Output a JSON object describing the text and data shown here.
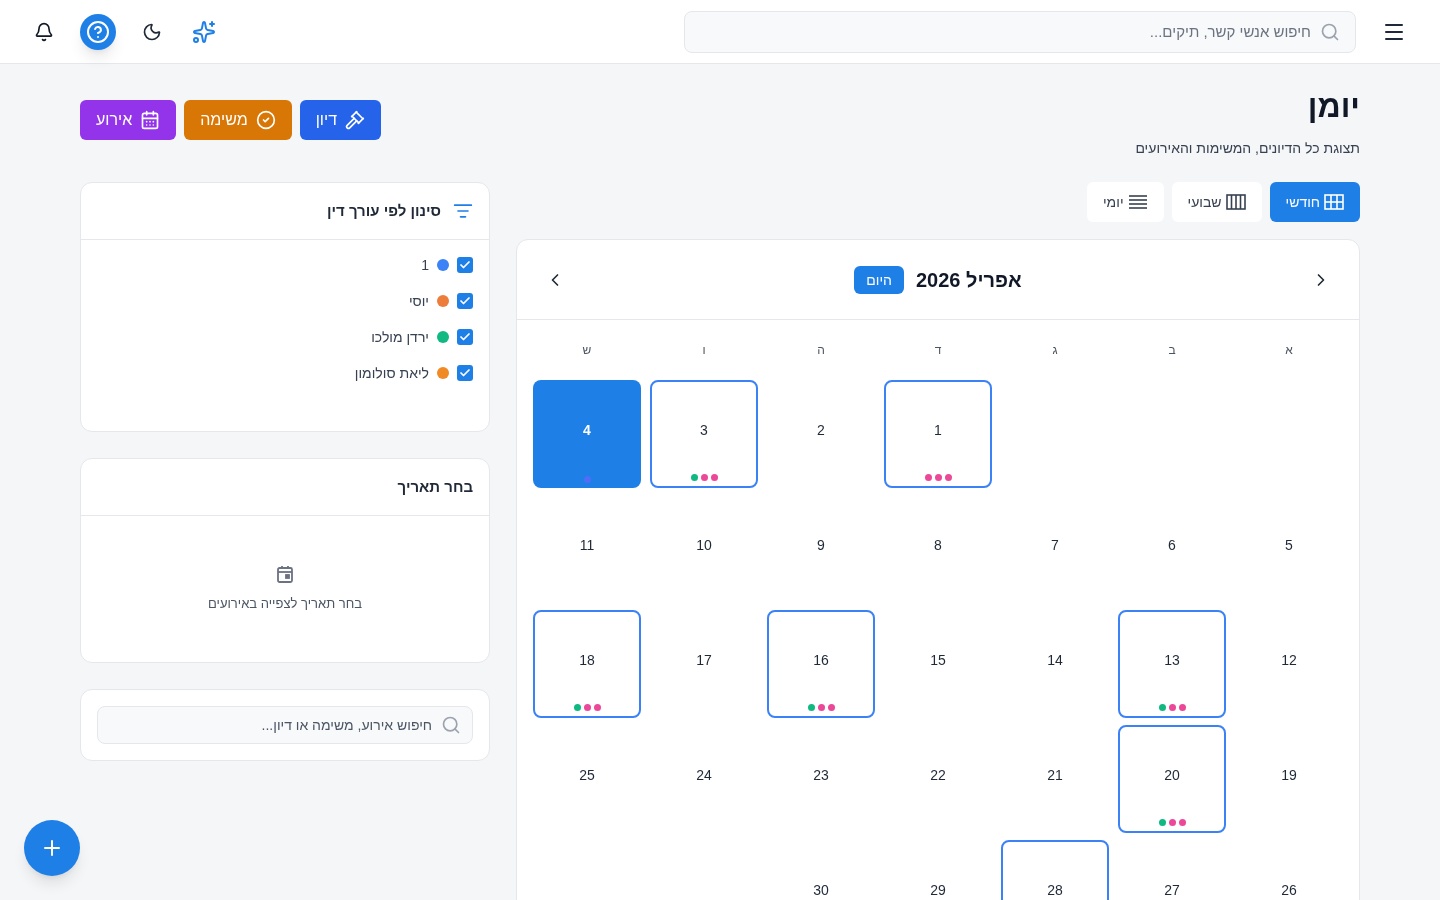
{
  "header": {
    "search": {
      "placeholder": "חיפוש אנשי קשר, תיקים..."
    }
  },
  "page": {
    "title": "יומן",
    "subtitle": "תצוגת כל הדיונים, המשימות והאירועים"
  },
  "create_buttons": [
    {
      "label": "דיון",
      "kind": "hearing"
    },
    {
      "label": "משימה",
      "kind": "task"
    },
    {
      "label": "אירוע",
      "kind": "event"
    }
  ],
  "view_tabs": [
    {
      "label": "חודשי",
      "kind": "month",
      "selected": true
    },
    {
      "label": "שבועי",
      "kind": "week",
      "selected": false
    },
    {
      "label": "יומי",
      "kind": "day",
      "selected": false
    }
  ],
  "calendar": {
    "title": "אפריל 2026",
    "today_button": "היום",
    "weekdays": [
      "א",
      "ב",
      "ג",
      "ד",
      "ה",
      "ו",
      "ש"
    ],
    "weeks": [
      [
        {
          "kind": "blank"
        },
        {
          "kind": "blank"
        },
        {
          "kind": "blank"
        },
        {
          "kind": "day",
          "day": "1",
          "today": false,
          "marked": true,
          "dots": [
            {
              "color": "#ec4899"
            },
            {
              "color": "#ec4899"
            },
            {
              "color": "#ec4899"
            }
          ]
        },
        {
          "kind": "day",
          "day": "2",
          "today": false,
          "marked": false
        },
        {
          "kind": "day",
          "day": "3",
          "today": false,
          "marked": true,
          "dots": [
            {
              "color": "#ec4899"
            },
            {
              "color": "#ec4899"
            },
            {
              "color": "#10b981"
            }
          ]
        },
        {
          "kind": "day",
          "day": "4",
          "today": true,
          "dots": [
            {
              "color": "#4f6ef7"
            }
          ]
        }
      ],
      [
        {
          "kind": "day",
          "day": "5",
          "today": false,
          "marked": false
        },
        {
          "kind": "day",
          "day": "6",
          "today": false,
          "marked": false
        },
        {
          "kind": "day",
          "day": "7",
          "today": false,
          "marked": false
        },
        {
          "kind": "day",
          "day": "8",
          "today": false,
          "marked": false
        },
        {
          "kind": "day",
          "day": "9",
          "today": false,
          "marked": false
        },
        {
          "kind": "day",
          "day": "10",
          "today": false,
          "marked": false
        },
        {
          "kind": "day",
          "day": "11",
          "today": false,
          "marked": false
        }
      ],
      [
        {
          "kind": "day",
          "day": "12",
          "today": false,
          "marked": false
        },
        {
          "kind": "day",
          "day": "13",
          "today": false,
          "marked": true,
          "dots": [
            {
              "color": "#ec4899"
            },
            {
              "color": "#ec4899"
            },
            {
              "color": "#10b981"
            }
          ]
        },
        {
          "kind": "day",
          "day": "14",
          "today": false,
          "marked": false
        },
        {
          "kind": "day",
          "day": "15",
          "today": false,
          "marked": false
        },
        {
          "kind": "day",
          "day": "16",
          "today": false,
          "marked": true,
          "dots": [
            {
              "color": "#ec4899"
            },
            {
              "color": "#ec4899"
            },
            {
              "color": "#10b981"
            }
          ]
        },
        {
          "kind": "day",
          "day": "17",
          "today": false,
          "marked": false
        },
        {
          "kind": "day",
          "day": "18",
          "today": false,
          "marked": true,
          "dots": [
            {
              "color": "#ec4899"
            },
            {
              "color": "#ec4899"
            },
            {
              "color": "#10b981"
            }
          ]
        }
      ],
      [
        {
          "kind": "day",
          "day": "19",
          "today": false,
          "marked": false
        },
        {
          "kind": "day",
          "day": "20",
          "today": false,
          "marked": true,
          "dots": [
            {
              "color": "#ec4899"
            },
            {
              "color": "#ec4899"
            },
            {
              "color": "#10b981"
            }
          ]
        },
        {
          "kind": "day",
          "day": "21",
          "today": false,
          "marked": false
        },
        {
          "kind": "day",
          "day": "22",
          "today": false,
          "marked": false
        },
        {
          "kind": "day",
          "day": "23",
          "today": false,
          "marked": false
        },
        {
          "kind": "day",
          "day": "24",
          "today": false,
          "marked": false
        },
        {
          "kind": "day",
          "day": "25",
          "today": false,
          "marked": false
        }
      ],
      [
        {
          "kind": "day",
          "day": "26",
          "today": false,
          "marked": false
        },
        {
          "kind": "day",
          "day": "27",
          "today": false,
          "marked": false
        },
        {
          "kind": "day",
          "day": "28",
          "today": false,
          "marked": true
        },
        {
          "kind": "day",
          "day": "29",
          "today": false,
          "marked": false
        },
        {
          "kind": "day",
          "day": "30",
          "today": false,
          "marked": false
        },
        {
          "kind": "blank"
        },
        {
          "kind": "blank"
        }
      ]
    ]
  },
  "filter": {
    "title": "סינון לפי עורך דין",
    "lawyers": [
      {
        "name": "1",
        "color": "#3b82f6",
        "checked": true
      },
      {
        "name": "יוסי",
        "color": "#ed7d3a",
        "checked": true
      },
      {
        "name": "ירדן מולכו",
        "color": "#10b981",
        "checked": true
      },
      {
        "name": "ליאת סולומון",
        "color": "#f08a24",
        "checked": true
      }
    ]
  },
  "date_panel": {
    "title": "בחר תאריך",
    "hint": "בחר תאריך לצפייה באירועים"
  },
  "event_search": {
    "placeholder": "חיפוש אירוע, משימה או דיון..."
  }
}
